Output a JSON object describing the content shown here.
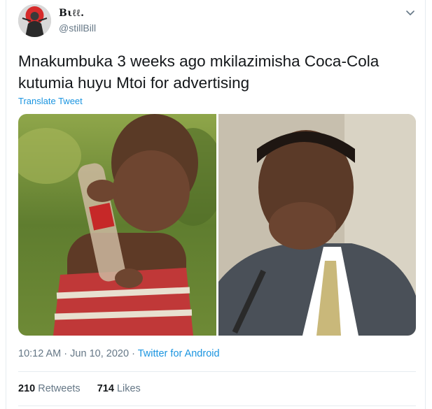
{
  "tweet": {
    "display_name": "Bιℓℓ.",
    "handle": "@stillBill",
    "text": "Mnakumbuka 3 weeks ago mkilazimisha Coca-Cola kutumia huyu Mtoi for advertising",
    "translate_label": "Translate Tweet",
    "time": "10:12 AM",
    "date": "Jun 10, 2020",
    "source": "Twitter for Android",
    "retweets_count": "210",
    "retweets_label": "Retweets",
    "likes_count": "714",
    "likes_label": "Likes",
    "meta_separator": "·"
  },
  "icons": {
    "menu": "chevron-down-icon"
  },
  "colors": {
    "link": "#1b95e0",
    "muted": "#657786",
    "text": "#14171a",
    "divider": "#e6ecf0"
  }
}
